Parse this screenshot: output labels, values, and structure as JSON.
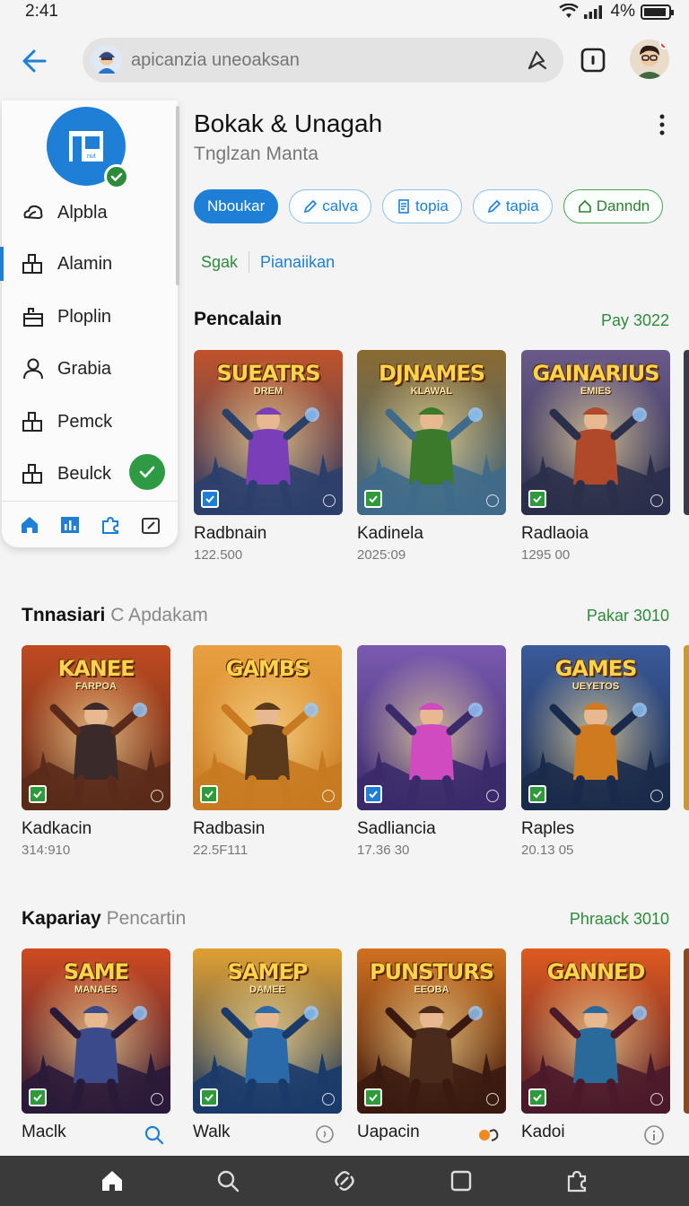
{
  "status": {
    "time": "2:41",
    "battery": "4%"
  },
  "search": {
    "placeholder": "apicanzia uneoaksan",
    "value": ""
  },
  "header": {
    "title": "Bokak & Unagah",
    "subtitle": "Tnglzan Manta"
  },
  "chips": [
    {
      "label": "Nboukar",
      "style": "filled",
      "icon": ""
    },
    {
      "label": "calva",
      "style": "outline",
      "icon": "pen-icon"
    },
    {
      "label": "topia",
      "style": "outline",
      "icon": "document-icon"
    },
    {
      "label": "tapia",
      "style": "outline",
      "icon": "pen-icon"
    },
    {
      "label": "Danndn",
      "style": "green",
      "icon": "home-outline-icon"
    }
  ],
  "subtabs": {
    "first": "Sgak",
    "second": "Pianaiikan"
  },
  "sidebar": {
    "items": [
      {
        "label": "Alpbla",
        "icon": "cloud-icon"
      },
      {
        "label": "Alamin",
        "icon": "blocks-icon"
      },
      {
        "label": "Ploplin",
        "icon": "bag-icon"
      },
      {
        "label": "Grabia",
        "icon": "person-icon"
      },
      {
        "label": "Pemck",
        "icon": "blocks-icon"
      },
      {
        "label": "Beulck",
        "icon": "blocks-icon"
      }
    ]
  },
  "sections": [
    {
      "title": "Pencalain",
      "title_light": "",
      "more": "Pay 3022",
      "cards": [
        {
          "name": "Radbnain",
          "meta": "122.500",
          "logo": "SUEATRS",
          "logo_sub": "DREM",
          "tag_color": "#1f7fd6"
        },
        {
          "name": "Kadinela",
          "meta": "2025:09",
          "logo": "DJNAMES",
          "logo_sub": "KLAWAL",
          "tag_color": "#2e9a3c"
        },
        {
          "name": "Radlaoia",
          "meta": "1295 00",
          "logo": "GAINARIUS",
          "logo_sub": "EMIES",
          "tag_color": "#2e9a3c"
        }
      ]
    },
    {
      "title": "Tnnasiari",
      "title_light": "C Apdakam",
      "more": "Pakar 3010",
      "cards": [
        {
          "name": "Kadkacin",
          "meta": "314:910",
          "logo": "KANEE",
          "logo_sub": "FARPOA",
          "tag_color": "#2e9a3c"
        },
        {
          "name": "Radbasin",
          "meta": "22.5F111",
          "logo": "GAMBS",
          "logo_sub": "",
          "tag_color": "#2e9a3c"
        },
        {
          "name": "Sadliancia",
          "meta": "17.36 30",
          "logo": "",
          "logo_sub": "",
          "tag_color": "#1f7fd6"
        },
        {
          "name": "Raples",
          "meta": "20.13 05",
          "logo": "GAMES",
          "logo_sub": "UEYETOS",
          "tag_color": "#2e9a3c"
        }
      ]
    },
    {
      "title": "Kapariay",
      "title_light": "Pencartin",
      "more": "Phraack 3010",
      "cards": [
        {
          "name": "Maclk",
          "meta": "",
          "logo": "SAME",
          "logo_sub": "MANAES",
          "tag_color": "#2e9a3c"
        },
        {
          "name": "Walk",
          "meta": "",
          "logo": "SAMEP",
          "logo_sub": "DAMEE",
          "tag_color": "#2e9a3c"
        },
        {
          "name": "Uapacin",
          "meta": "",
          "logo": "PUNSTURS",
          "logo_sub": "EEOBA",
          "tag_color": "#2e9a3c"
        },
        {
          "name": "Kadoi",
          "meta": "",
          "logo": "GANNED",
          "logo_sub": "",
          "tag_color": "#2e9a3c"
        }
      ]
    }
  ],
  "bottom_nav": [
    "home-icon",
    "search-icon",
    "link-icon",
    "square-icon",
    "puzzle-icon"
  ],
  "colors": {
    "accent": "#1f7fd6",
    "green": "#2e8b3b"
  }
}
